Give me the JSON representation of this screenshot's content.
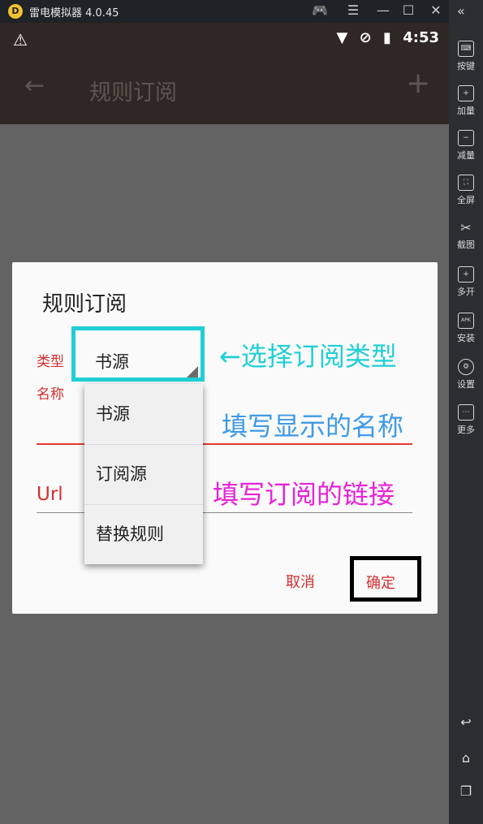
{
  "emulator": {
    "title": "雷电模拟器 4.0.45",
    "sidebar": [
      {
        "label": "按键",
        "icon": "keyboard-icon"
      },
      {
        "label": "加量",
        "icon": "volume-up-icon"
      },
      {
        "label": "减量",
        "icon": "volume-down-icon"
      },
      {
        "label": "全屏",
        "icon": "fullscreen-icon"
      },
      {
        "label": "截图",
        "icon": "scissors-icon"
      },
      {
        "label": "多开",
        "icon": "multi-instance-icon"
      },
      {
        "label": "安装",
        "icon": "apk-icon"
      },
      {
        "label": "设置",
        "icon": "gear-icon"
      },
      {
        "label": "更多",
        "icon": "more-icon"
      }
    ]
  },
  "statusbar": {
    "time": "4:53"
  },
  "toolbar": {
    "title": "规则订阅"
  },
  "dialog": {
    "title": "规则订阅",
    "type_label": "类型",
    "selected_type": "书源",
    "name_label": "名称",
    "url_label": "Url",
    "cancel": "取消",
    "confirm": "确定"
  },
  "dropdown": {
    "options": [
      "书源",
      "订阅源",
      "替换规则"
    ]
  },
  "annotations": {
    "select_type": "←选择订阅类型",
    "fill_name": "填写显示的名称",
    "fill_link": "填写订阅的链接"
  },
  "colors": {
    "accent": "#d32f2f",
    "annotation_cyan": "#20cfd6",
    "annotation_blue": "#3f9ae6",
    "annotation_magenta": "#e822d8"
  }
}
